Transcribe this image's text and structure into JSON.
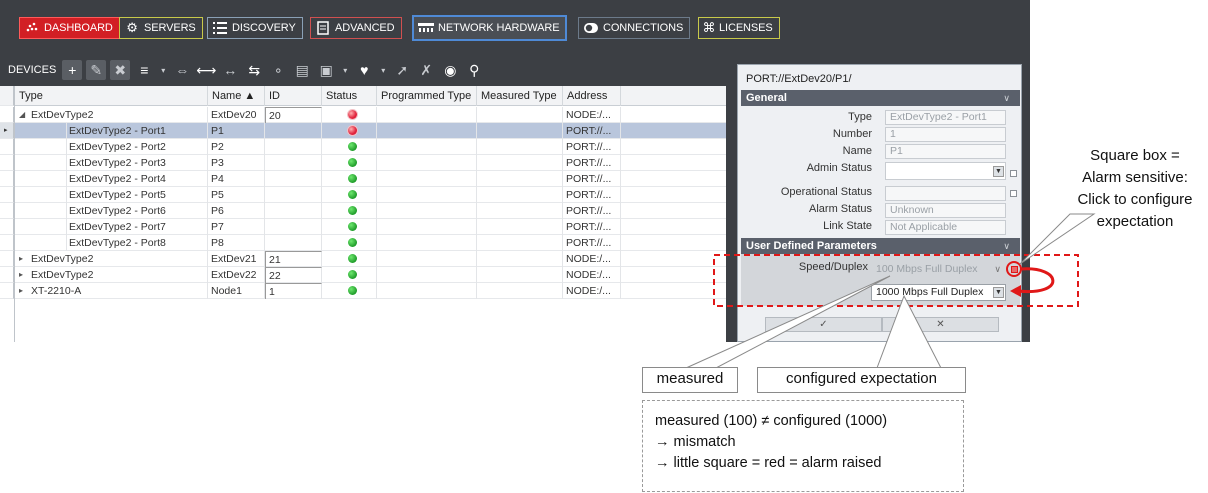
{
  "nav": {
    "tabs": [
      {
        "label": "DASHBOARD",
        "icon": "dashboard-dots-icon"
      },
      {
        "label": "SERVERS",
        "icon": "gear-icon"
      },
      {
        "label": "DISCOVERY",
        "icon": "list-icon"
      },
      {
        "label": "ADVANCED",
        "icon": "document-icon"
      },
      {
        "label": "NETWORK HARDWARE",
        "icon": "network-icon",
        "active": true
      },
      {
        "label": "CONNECTIONS",
        "icon": "toggle-icon"
      },
      {
        "label": "LICENSES",
        "icon": "key-icon"
      }
    ]
  },
  "toolbar": {
    "title": "DEVICES"
  },
  "grid": {
    "columns": [
      "Type",
      "Name ▲",
      "ID",
      "Status",
      "Programmed Type",
      "Measured Type",
      "Address"
    ],
    "rows": [
      {
        "type": "ExtDevType2",
        "name": "ExtDev20",
        "id": "20",
        "status": "red",
        "address": "NODE:/...",
        "level": 0,
        "expander": "◢",
        "expanded": true
      },
      {
        "type": "ExtDevType2 - Port1",
        "name": "P1",
        "id": "",
        "status": "red",
        "address": "PORT://...",
        "level": 1,
        "selected": true
      },
      {
        "type": "ExtDevType2 - Port2",
        "name": "P2",
        "id": "",
        "status": "green",
        "address": "PORT://...",
        "level": 1
      },
      {
        "type": "ExtDevType2 - Port3",
        "name": "P3",
        "id": "",
        "status": "green",
        "address": "PORT://...",
        "level": 1
      },
      {
        "type": "ExtDevType2 - Port4",
        "name": "P4",
        "id": "",
        "status": "green",
        "address": "PORT://...",
        "level": 1
      },
      {
        "type": "ExtDevType2 - Port5",
        "name": "P5",
        "id": "",
        "status": "green",
        "address": "PORT://...",
        "level": 1
      },
      {
        "type": "ExtDevType2 - Port6",
        "name": "P6",
        "id": "",
        "status": "green",
        "address": "PORT://...",
        "level": 1
      },
      {
        "type": "ExtDevType2 - Port7",
        "name": "P7",
        "id": "",
        "status": "green",
        "address": "PORT://...",
        "level": 1
      },
      {
        "type": "ExtDevType2 - Port8",
        "name": "P8",
        "id": "",
        "status": "green",
        "address": "PORT://...",
        "level": 1
      },
      {
        "type": "ExtDevType2",
        "name": "ExtDev21",
        "id": "21",
        "status": "green",
        "address": "NODE:/...",
        "level": 0,
        "expander": "▸"
      },
      {
        "type": "ExtDevType2",
        "name": "ExtDev22",
        "id": "22",
        "status": "green",
        "address": "NODE:/...",
        "level": 0,
        "expander": "▸"
      },
      {
        "type": "XT-2210-A",
        "name": "Node1",
        "id": "1",
        "status": "green",
        "address": "NODE:/...",
        "level": 0,
        "expander": "▸"
      }
    ]
  },
  "panel": {
    "title": "PORT://ExtDev20/P1/",
    "general": {
      "header": "General",
      "fields": [
        {
          "label": "Type",
          "value": "ExtDevType2 - Port1"
        },
        {
          "label": "Number",
          "value": "1"
        },
        {
          "label": "Name",
          "value": "P1"
        },
        {
          "label": "Admin Status",
          "value": ""
        },
        {
          "label": "Operational Status",
          "value": ""
        },
        {
          "label": "Alarm Status",
          "value": "Unknown"
        },
        {
          "label": "Link State",
          "value": "Not Applicable"
        }
      ]
    },
    "user_defined": {
      "header": "User Defined Parameters",
      "speed_label": "Speed/Duplex",
      "measured_value": "100 Mbps Full Duplex",
      "configured_value": "1000 Mbps Full Duplex"
    },
    "ok_label": "✓",
    "cancel_label": "✕"
  },
  "annotations": {
    "square_box": [
      "Square box =",
      "Alarm sensitive:",
      "Click to configure",
      "expectation"
    ],
    "measured": "measured",
    "configured": "configured expectation",
    "note": [
      "measured (100) ≠ configured (1000)",
      "→ mismatch",
      "→ little square = red = alarm raised"
    ],
    "colors": {
      "alarm": "#e0203a",
      "ok": "#1f9c2a",
      "highlight": "#e01818"
    }
  }
}
